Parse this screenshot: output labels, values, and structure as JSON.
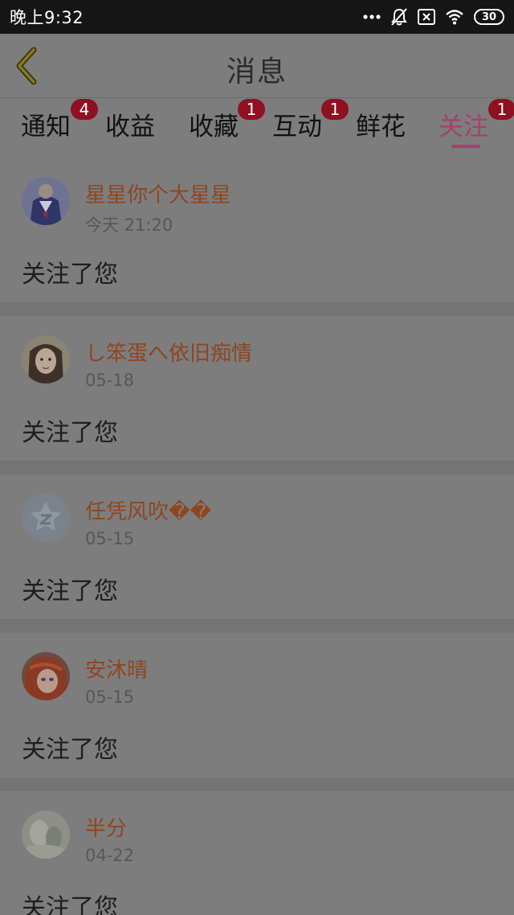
{
  "status_bar": {
    "time": "晚上9:32",
    "icons": [
      "more-dots-icon",
      "bell-muted-icon",
      "no-sim-icon",
      "wifi-icon",
      "battery-icon"
    ],
    "battery_level": "30"
  },
  "header": {
    "title": "消息",
    "back_icon": "chevron-left-icon"
  },
  "tabs": [
    {
      "label": "通知",
      "badge": "4"
    },
    {
      "label": "收益",
      "badge": ""
    },
    {
      "label": "收藏",
      "badge": "1"
    },
    {
      "label": "互动",
      "badge": "1"
    },
    {
      "label": "鲜花",
      "badge": ""
    },
    {
      "label": "关注",
      "badge": "1",
      "active": true
    }
  ],
  "colors": {
    "accent": "#a83f6e",
    "badge": "#8f1020",
    "username": "#8f4620"
  },
  "follows": [
    {
      "username": "星星你个大星星",
      "time": "今天 21:20",
      "message": "关注了您"
    },
    {
      "username": "し笨蛋へ依旧痴情",
      "time": "05-18",
      "message": "关注了您"
    },
    {
      "username": "任凭风吹��",
      "time": "05-15",
      "message": "关注了您"
    },
    {
      "username": "安沐晴",
      "time": "05-15",
      "message": "关注了您"
    },
    {
      "username": "半分",
      "time": "04-22",
      "message": "关注了您"
    }
  ]
}
